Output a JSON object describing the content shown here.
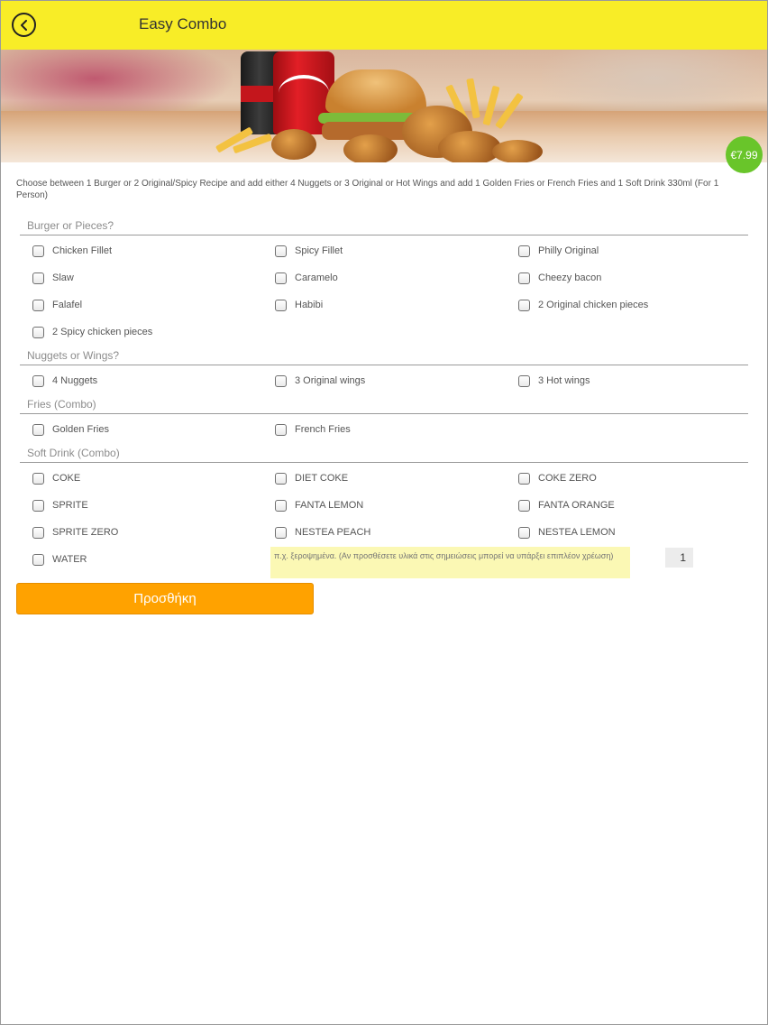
{
  "header": {
    "title": "Easy Combo",
    "back_icon": "back-arrow-circle-icon",
    "background_color": "#f8ed27"
  },
  "banner": {
    "image_description_icon": "combo-food-banner"
  },
  "price": {
    "label": "€7.99",
    "color": "#69c52a"
  },
  "description": "Choose between 1 Burger or 2 Original/Spicy Recipe and add either 4 Nuggets or 3 Original or Hot Wings and add 1 Golden Fries or French Fries and 1 Soft Drink 330ml (For 1 Person)",
  "sections": [
    {
      "title": "Burger or Pieces?",
      "options": [
        "Chicken Fillet",
        "Spicy Fillet",
        "Philly Original",
        "Slaw",
        "Caramelo",
        "Cheezy bacon",
        "Falafel",
        "Habibi",
        "2 Original chicken pieces",
        "2 Spicy chicken pieces"
      ]
    },
    {
      "title": "Nuggets or Wings?",
      "options": [
        "4 Nuggets",
        "3 Original wings",
        "3 Hot wings"
      ]
    },
    {
      "title": "Fries (Combo)",
      "options": [
        "Golden Fries",
        "French Fries"
      ]
    },
    {
      "title": "Soft Drink (Combo)",
      "options": [
        "COKE",
        "DIET COKE",
        "COKE ZERO",
        "SPRITE",
        "FANTA LEMON",
        "FANTA ORANGE",
        "SPRITE ZERO",
        "NESTEA PEACH",
        "NESTEA LEMON",
        "WATER"
      ]
    }
  ],
  "notes": {
    "placeholder": "π.χ. ξεροψημένα. (Αν προσθέσετε υλικά στις σημειώσεις μπορεί να υπάρξει επιπλέον χρέωση)",
    "value": ""
  },
  "quantity": "1",
  "add_button": {
    "label": "Προσθήκη",
    "color": "#ffa200"
  }
}
